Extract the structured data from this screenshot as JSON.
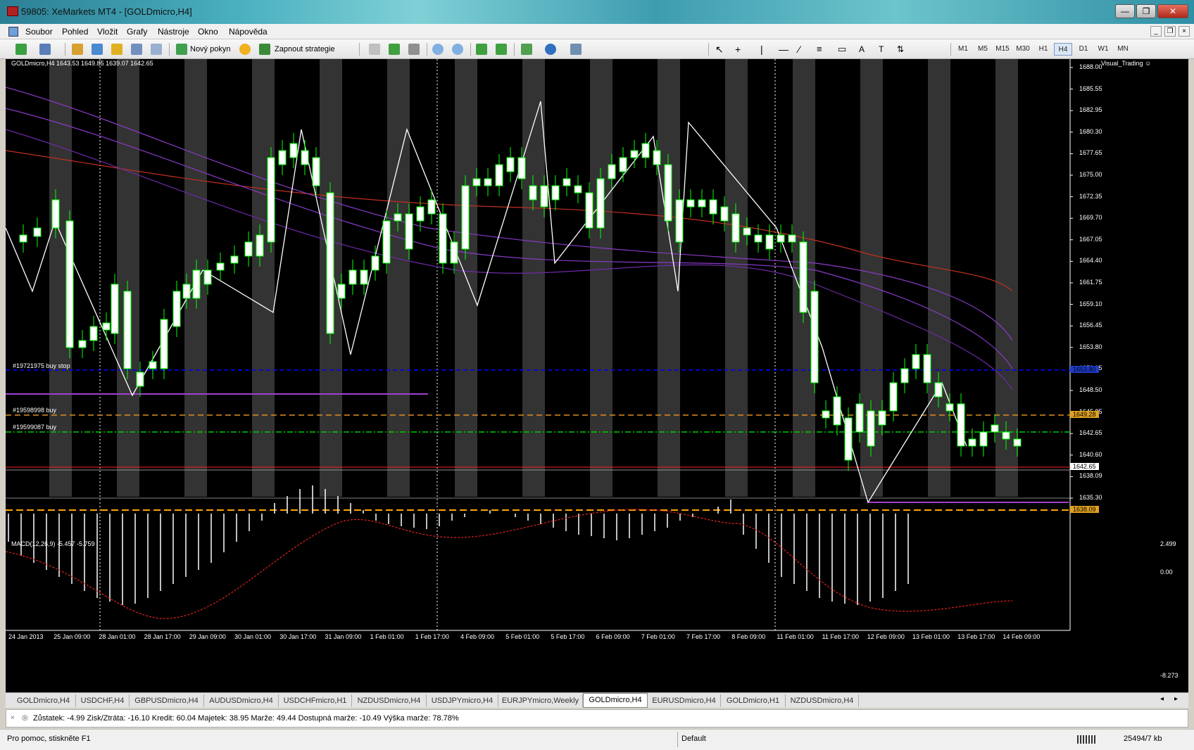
{
  "window": {
    "title": "59805: XeMarkets MT4 - [GOLDmicro,H4]",
    "buttons": [
      "—",
      "❐",
      "✕"
    ]
  },
  "menu": {
    "items": [
      "Soubor",
      "Pohled",
      "Vložit",
      "Grafy",
      "Nástroje",
      "Okno",
      "Nápověda"
    ]
  },
  "toolbar": {
    "new_order": "Nový pokyn",
    "strategies": "Zapnout strategie",
    "timeframes": [
      "M1",
      "M5",
      "M15",
      "M30",
      "H1",
      "H4",
      "D1",
      "W1",
      "MN"
    ],
    "active_timeframe": "H4"
  },
  "chart": {
    "header": "GOLDmicro,H4  1643.53 1649.85 1639.07 1642.65",
    "indicator_label": "Visual_Trading ☺",
    "macd_label": "MACD(12,26,9) -5.457 -5.759",
    "order_labels": [
      "#19721975 buy stop",
      "#19598998 buy",
      "#19599087 buy"
    ],
    "price_labels": [
      "1688.00",
      "1685.55",
      "1682.95",
      "1680.30",
      "1677.65",
      "1675.00",
      "1672.35",
      "1669.70",
      "1667.05",
      "1664.40",
      "1661.75",
      "1659.10",
      "1656.45",
      "1653.80",
      "1651.15",
      "1648.50",
      "1645.85",
      "1642.65",
      "1640.60",
      "1638.09",
      "1635.30"
    ],
    "macd_scale": [
      "2.499",
      "0.00",
      "-8.273"
    ],
    "highlight_prices": {
      "buy_stop": "1653.80",
      "buy1": "1649.28",
      "current": "1642.65",
      "sl": "1638.09"
    },
    "date_labels": [
      "24 Jan 2013",
      "25 Jan 09:00",
      "28 Jan 01:00",
      "28 Jan 17:00",
      "29 Jan 09:00",
      "30 Jan 01:00",
      "30 Jan 17:00",
      "31 Jan 09:00",
      "1 Feb 01:00",
      "1 Feb 17:00",
      "4 Feb 09:00",
      "5 Feb 01:00",
      "5 Feb 17:00",
      "6 Feb 09:00",
      "7 Feb 01:00",
      "7 Feb 17:00",
      "8 Feb 09:00",
      "11 Feb 01:00",
      "11 Feb 17:00",
      "12 Feb 09:00",
      "13 Feb 01:00",
      "13 Feb 17:00",
      "14 Feb 09:00"
    ],
    "colors": {
      "background": "#000000",
      "bull_body": "#ffffff",
      "wick": "#00ff00",
      "zigzag": "#ffffff",
      "ema_red": "#c03020",
      "ema_purple": "#8a3ac8",
      "buy_stop_line": "#0000ff",
      "order_line": "#00cc00",
      "sl_line": "#ffa500",
      "current_line": "#ff2020",
      "period_bands": "#333333"
    }
  },
  "tabs": {
    "items": [
      "GOLDmicro,H4",
      "USDCHF,H4",
      "GBPUSDmicro,H4",
      "AUDUSDmicro,H4",
      "USDCHFmicro,H1",
      "NZDUSDmicro,H4",
      "USDJPYmicro,H4",
      "EURJPYmicro,Weekly",
      "GOLDmicro,H4",
      "EURUSDmicro,H4",
      "GOLDmicro,H1",
      "NZDUSDmicro,H4"
    ],
    "active_index": 8
  },
  "account": {
    "text": "Zůstatek: -4.99  Zisk/Ztráta: -16.10  Kredit: 60.04  Majetek: 38.95  Marže: 49.44  Dostupná marže: -10.49  Výška marže: 78.78%"
  },
  "status": {
    "help": "Pro pomoc, stiskněte F1",
    "profile": "Default",
    "traffic": "25494/7 kb"
  }
}
